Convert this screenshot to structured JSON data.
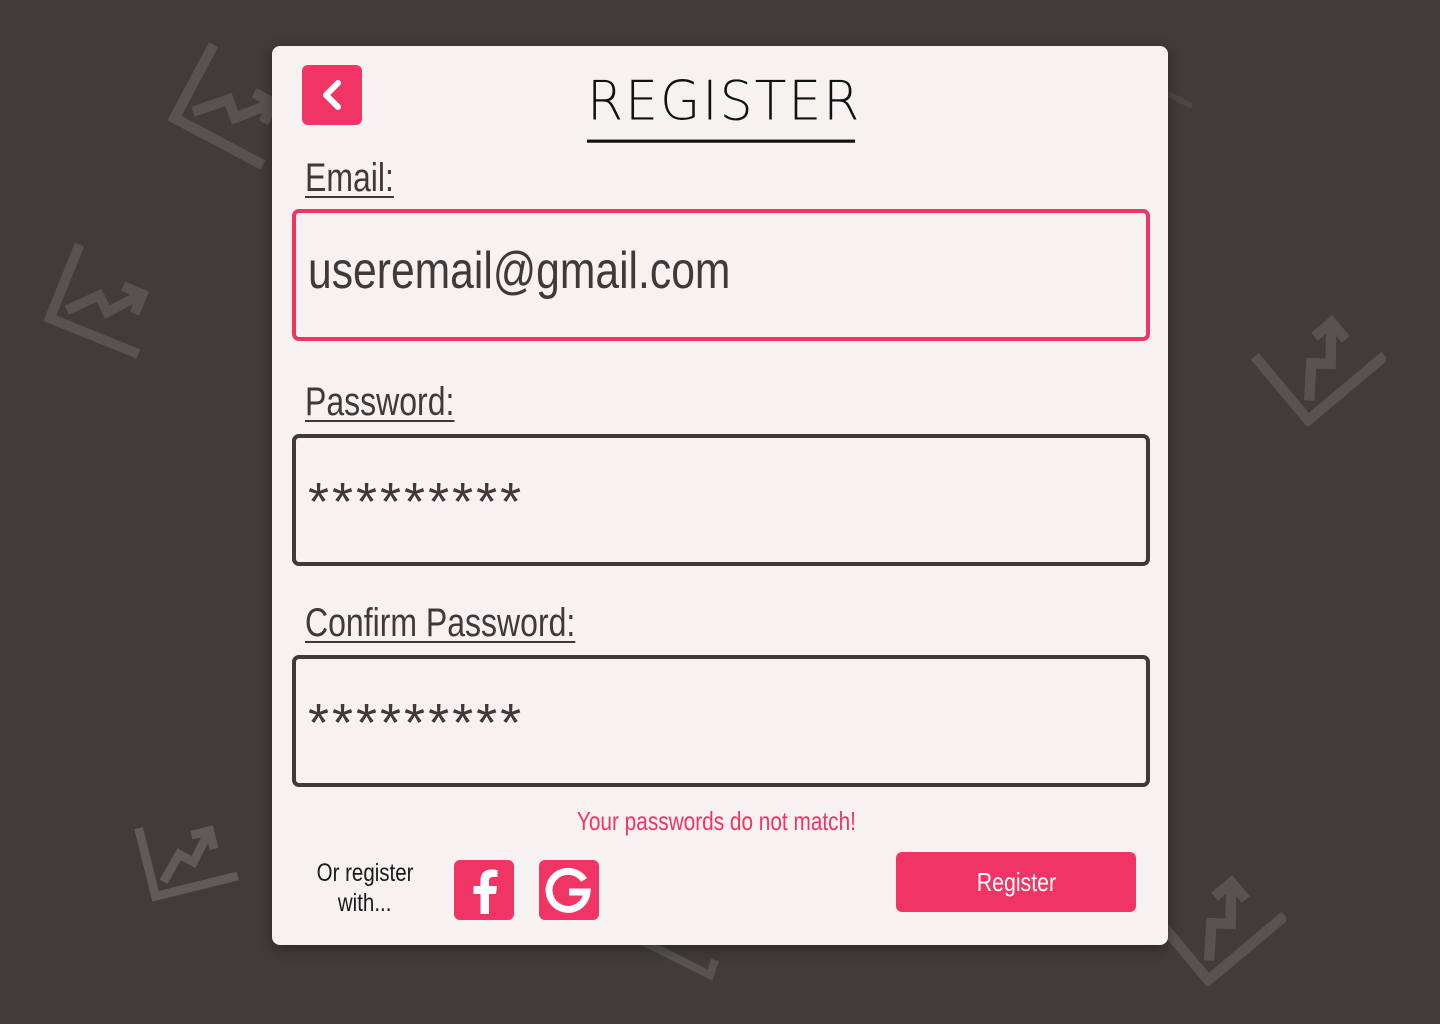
{
  "title": "REGISTER",
  "back": {
    "icon": "chevron-left-icon"
  },
  "email": {
    "label": "Email:",
    "value": "useremail@gmail.com"
  },
  "password": {
    "label": "Password:",
    "value": "*********"
  },
  "confirm_password": {
    "label": "Confirm Password:",
    "value": "*********"
  },
  "error_message": "Your passwords do not match!",
  "social": {
    "prompt": "Or register with...",
    "prompt_line1": "Or register",
    "prompt_line2": "with...",
    "providers": [
      "facebook-icon",
      "google-icon"
    ]
  },
  "register_button": "Register",
  "background_icon": "trending-chart-icon",
  "colors": {
    "accent": "#f03565",
    "background": "#403c3b",
    "card": "#f6f2f1",
    "text": "#3e3a39"
  }
}
